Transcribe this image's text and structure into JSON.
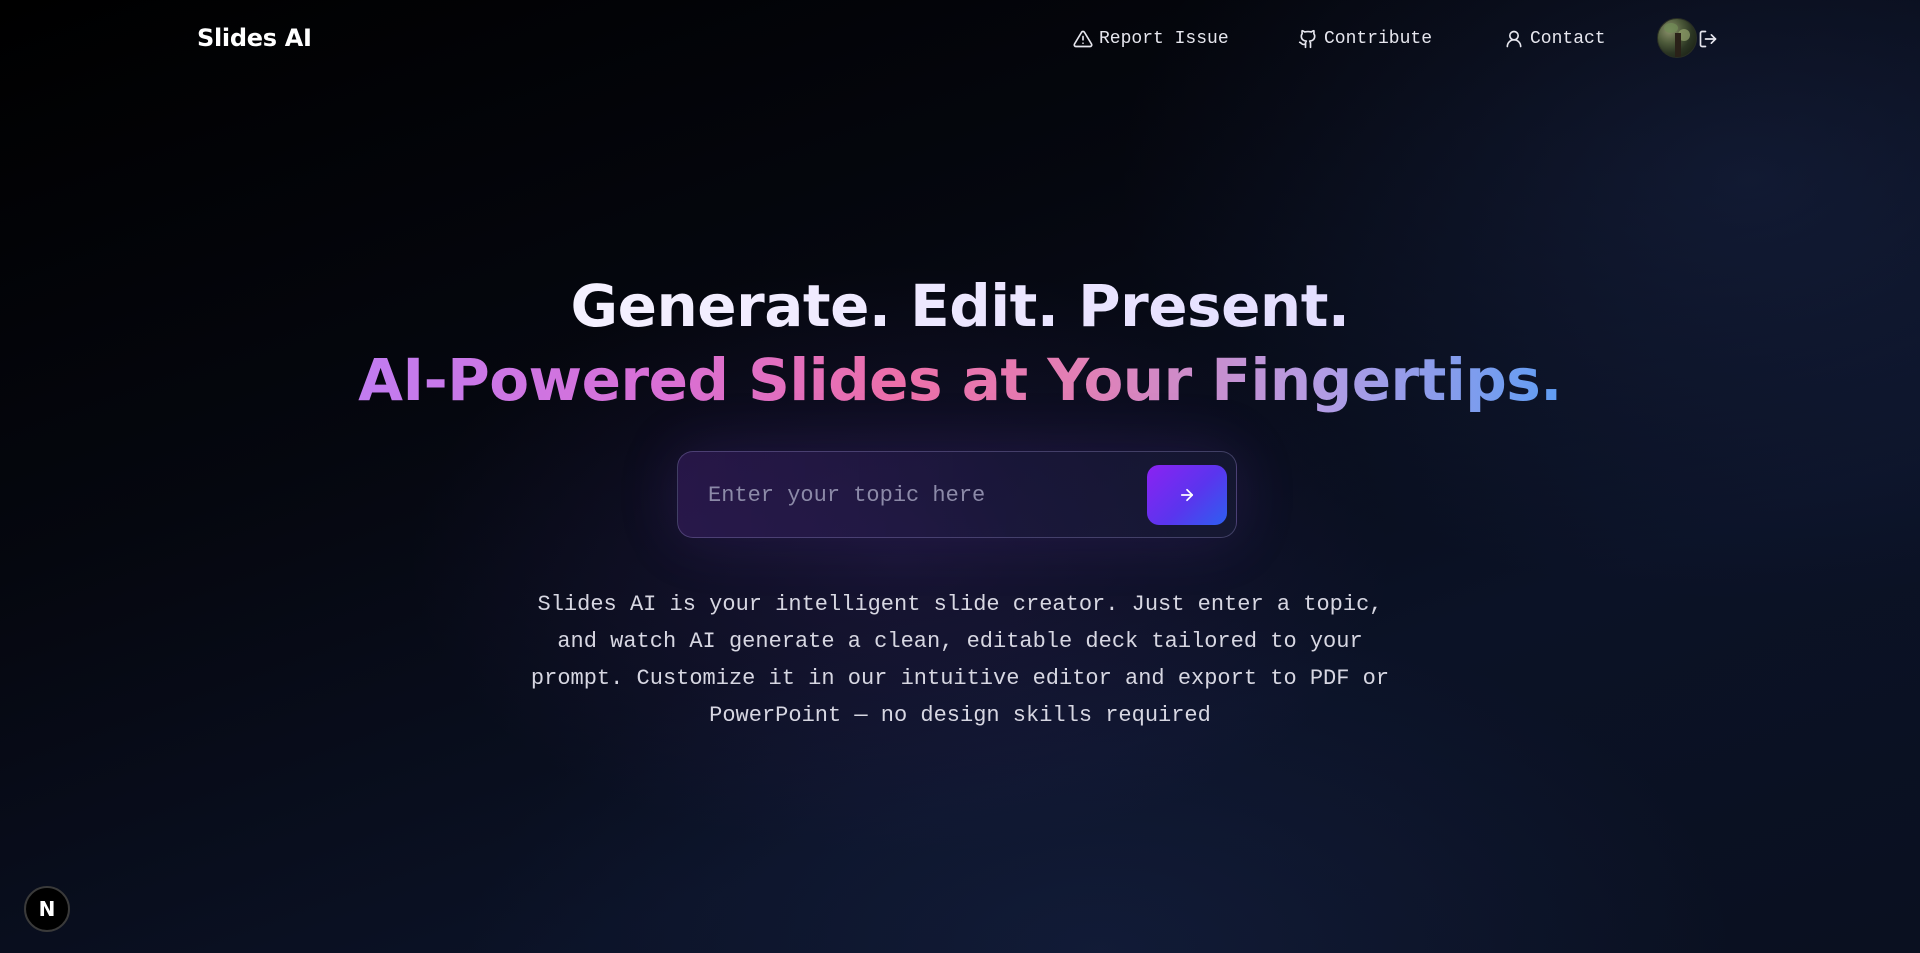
{
  "header": {
    "brand": "Slides AI",
    "nav": {
      "report": "Report Issue",
      "contribute": "Contribute",
      "contact": "Contact"
    },
    "icons": {
      "report": "alert-triangle-icon",
      "contribute": "github-icon",
      "contact": "user-icon",
      "logout": "logout-icon"
    }
  },
  "hero": {
    "line1": "Generate. Edit. Present.",
    "line2": "AI-Powered Slides at Your Fingertips."
  },
  "search": {
    "placeholder": "Enter your topic here",
    "value": ""
  },
  "description": "Slides AI is your intelligent slide creator. Just enter a topic, and watch AI generate a clean, editable deck tailored to your prompt. Customize it in our intuitive editor and export to PDF or PowerPoint — no design skills required",
  "badge": {
    "letter": "N"
  },
  "colors": {
    "accent_start": "#8b22f2",
    "accent_end": "#2d5ff0",
    "gradient_pink": "#ec6fa9",
    "gradient_blue": "#5f9df3"
  }
}
